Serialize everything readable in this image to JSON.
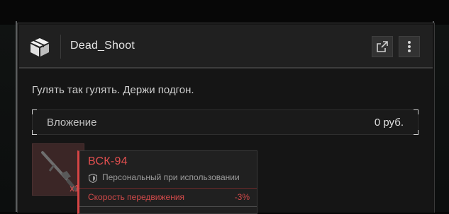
{
  "mail": {
    "sender": "Dead_Shoot",
    "app_icon": "package-icon",
    "external_icon": "external-link-icon",
    "menu_icon": "kebab-menu-icon",
    "message": "Гулять так гулять. Держи подгон.",
    "attachment": {
      "label": "Вложение",
      "amount": "0 руб."
    },
    "item": {
      "quantity": "x1",
      "name": "ВСК-94",
      "binding_icon": "shield-icon",
      "binding": "Персональный при использовании",
      "stats": [
        {
          "label": "Скорость передвижения",
          "value": "-3%"
        },
        {
          "label": "",
          "value": ""
        }
      ]
    }
  },
  "colors": {
    "accent_red": "#d64545",
    "panel_bg": "#151515",
    "header_bg": "#202020"
  }
}
